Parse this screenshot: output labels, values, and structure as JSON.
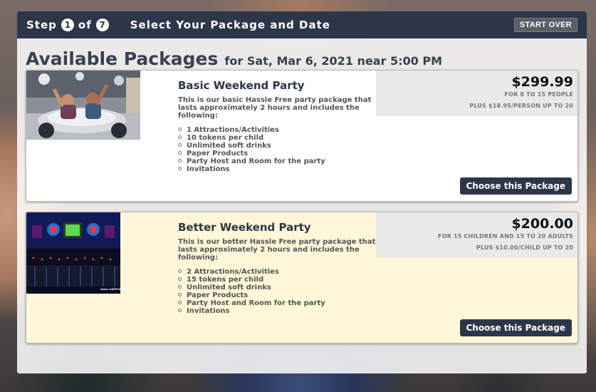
{
  "header": {
    "step_word": "Step",
    "step_current": "1",
    "of_word": "of",
    "step_total": "7",
    "title": "Select Your Package and Date",
    "start_over": "START OVER"
  },
  "page": {
    "title": "Available Packages",
    "date_line": "for Sat, Mar 6, 2021 near 5:00 PM"
  },
  "packages": [
    {
      "name": "Basic Weekend Party",
      "description": "This is our basic Hassle Free party package that lasts approximately 2 hours and includes the following:",
      "items": [
        "1 Attractions/Activities",
        "10 tokens per child",
        "Unlimited soft drinks",
        "Paper Products",
        "Party Host and Room for the party",
        "Invitations"
      ],
      "price": "$299.99",
      "price_note": "FOR 8 TO 15 PEOPLE",
      "price_extra": "PLUS $18.95/PERSON UP TO 20",
      "button": "Choose this Package",
      "image": "go-kart-kids-photo"
    },
    {
      "name": "Better Weekend Party",
      "description": "This is our better Hassle Free party package that lasts approximately 2 hours and includes the following:",
      "items": [
        "2 Attractions/Activities",
        "15 tokens per child",
        "Unlimited soft drinks",
        "Paper Products",
        "Party Host and Room for the party",
        "Invitations"
      ],
      "price": "$200.00",
      "price_note": "FOR 15 CHILDREN AND 15 TO 20 ADULTS",
      "price_extra": "PLUS $10.00/CHILD UP TO 20",
      "button": "Choose this Package",
      "image": "laser-tag-arena-photo",
      "image_caption": "www.LASERTAGWORLD.com"
    }
  ],
  "colors": {
    "header_bg": "#2d3649",
    "button_bg": "#2d3649",
    "package2_bg": "#fff7d8",
    "price_box_bg": "#e9e9e9"
  }
}
